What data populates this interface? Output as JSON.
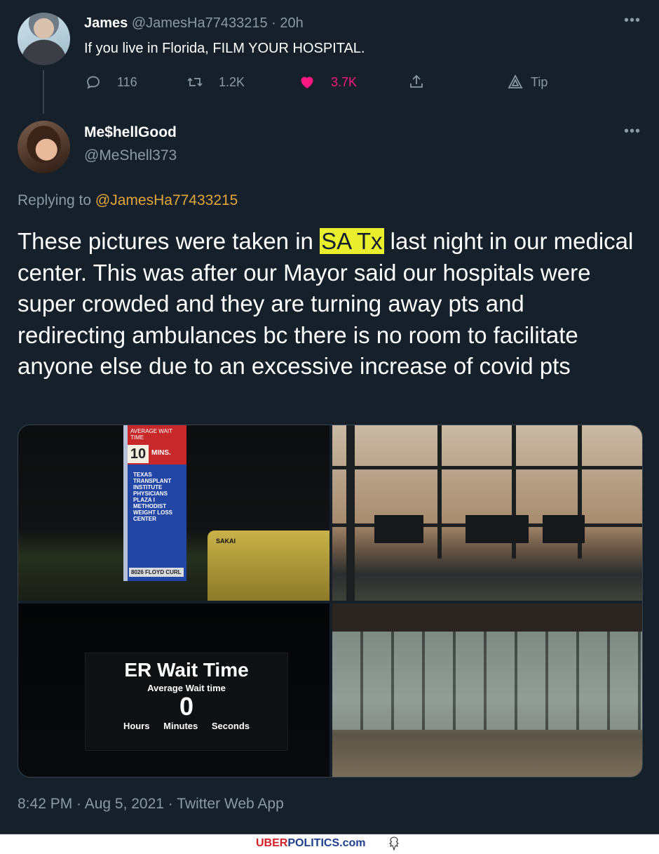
{
  "parent_tweet": {
    "name": "James",
    "handle": "@JamesHa77433215",
    "time": "20h",
    "separator": "·",
    "text": "If you live in Florida, FILM YOUR HOSPITAL.",
    "more": "•••",
    "actions": {
      "reply_count": "116",
      "retweet_count": "1.2K",
      "like_count": "3.7K",
      "tip_label": "Tip"
    }
  },
  "main_tweet": {
    "name": "Me$hellGood",
    "handle": "@MeShell373",
    "more": "•••",
    "replying_prefix": "Replying to",
    "replying_to": "@JamesHa77433215",
    "text_before": "These pictures were taken in",
    "text_highlight": "SA Tx",
    "text_after": "last night in our medical center. This was after our Mayor said our hospitals were super crowded and they are turning away pts and redirecting ambulances bc there is no room to facilitate anyone else due to an excessive increase of covid pts",
    "highlight_color": "#e9ef2c",
    "photos": {
      "sign": {
        "top_text": "AVERAGE WAIT TIME",
        "minutes": "10",
        "mins_label": "MINS.",
        "list": [
          "TEXAS",
          "TRANSPLANT",
          "INSTITUTE",
          "PHYSICIANS",
          "PLAZA I",
          "METHODIST",
          "WEIGHT LOSS",
          "CENTER"
        ],
        "street": "8026 FLOYD CURL",
        "machine_label": "SAKAI"
      },
      "er_board": {
        "title": "ER Wait Time",
        "subtitle": "Average Wait time",
        "value": "0",
        "units": "Hours Minutes Seconds"
      }
    },
    "timestamp": "8:42 PM · Aug 5, 2021 · Twitter Web App"
  },
  "watermark": {
    "uber": "UBER",
    "politics": "POLITICS.com"
  },
  "colors": {
    "background": "#15202b",
    "secondary_text": "#8b98a5",
    "like_pink": "#f91880",
    "mention": "#e3a63a"
  }
}
